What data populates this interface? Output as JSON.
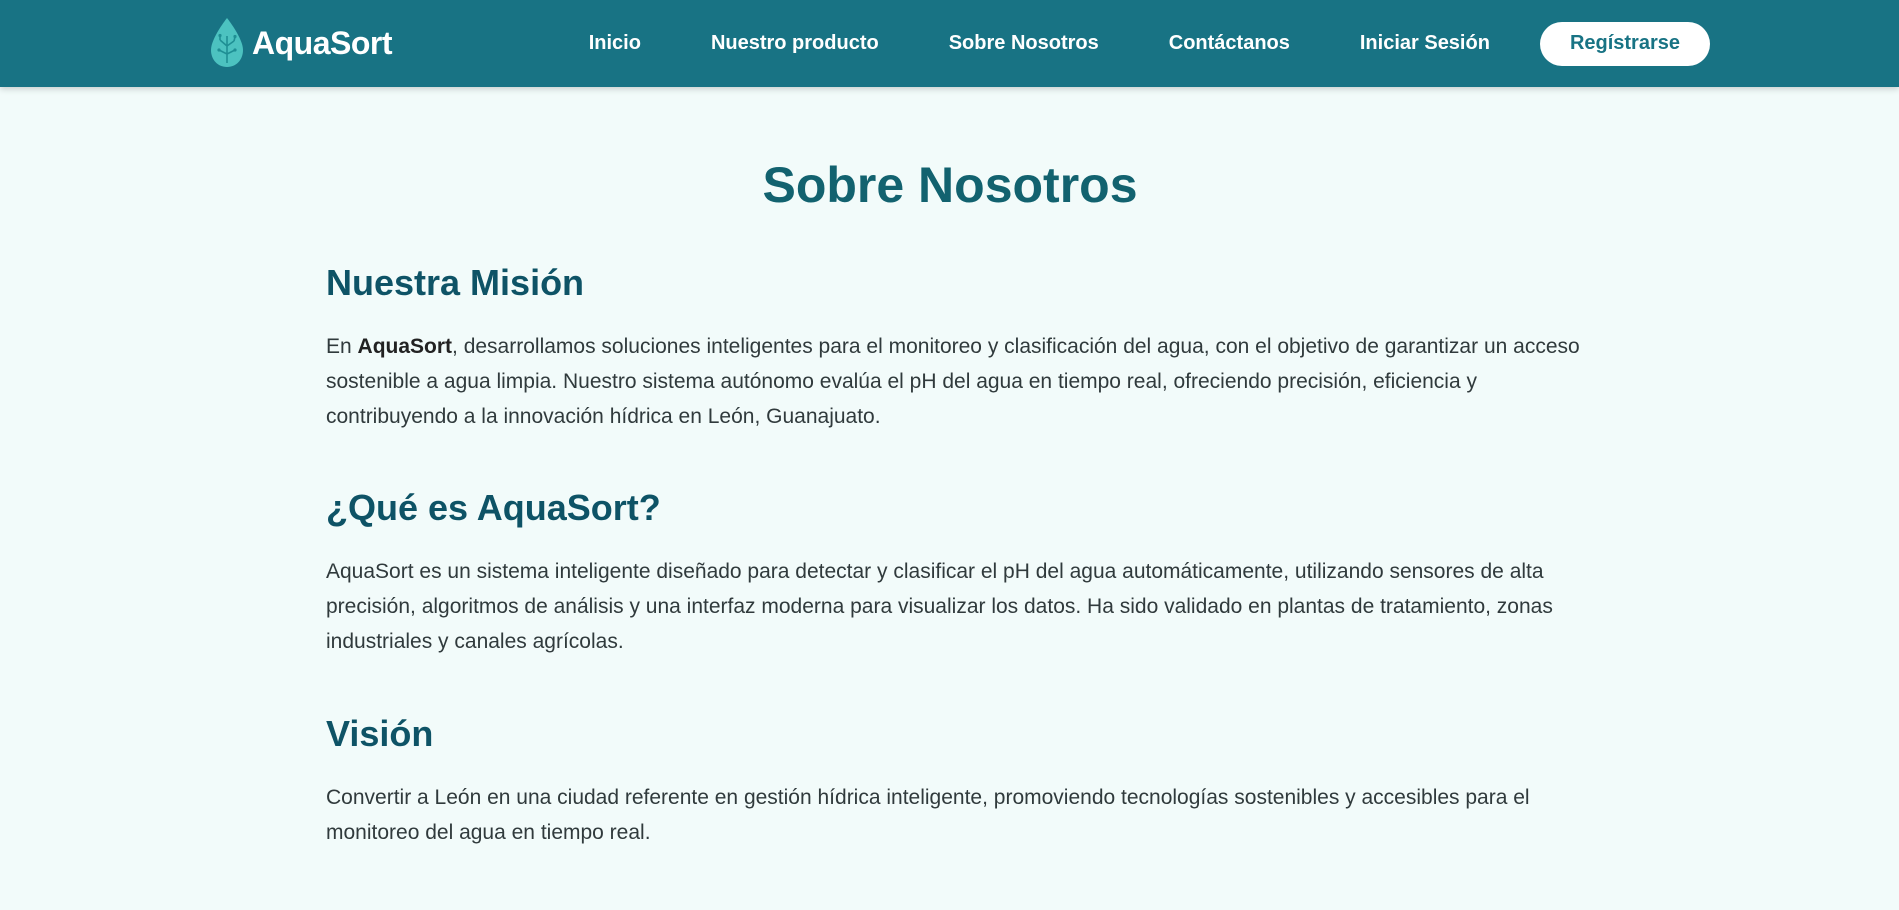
{
  "brand": {
    "name": "AquaSort",
    "logo_icon": "water-drop-circuit-icon"
  },
  "nav": {
    "items": [
      {
        "label": "Inicio"
      },
      {
        "label": "Nuestro producto"
      },
      {
        "label": "Sobre Nosotros"
      },
      {
        "label": "Contáctanos"
      },
      {
        "label": "Iniciar Sesión"
      }
    ],
    "register_label": "Regístrarse"
  },
  "page": {
    "title": "Sobre Nosotros"
  },
  "sections": [
    {
      "heading": "Nuestra Misión",
      "body_prefix": "En ",
      "body_strong": "AquaSort",
      "body": ", desarrollamos soluciones inteligentes para el monitoreo y clasificación del agua, con el objetivo de garantizar un acceso sostenible a agua limpia. Nuestro sistema autónomo evalúa el pH del agua en tiempo real, ofreciendo precisión, eficiencia y contribuyendo a la innovación hídrica en León, Guanajuato."
    },
    {
      "heading": "¿Qué es AquaSort?",
      "body": "AquaSort es un sistema inteligente diseñado para detectar y clasificar el pH del agua automáticamente, utilizando sensores de alta precisión, algoritmos de análisis y una interfaz moderna para visualizar los datos. Ha sido validado en plantas de tratamiento, zonas industriales y canales agrícolas."
    },
    {
      "heading": "Visión",
      "body": "Convertir a León en una ciudad referente en gestión hídrica inteligente, promoviendo tecnologías sostenibles y accesibles para el monitoreo del agua en tiempo real."
    }
  ],
  "colors": {
    "navbar": "#187384",
    "page_background": "#f2fbfa",
    "title": "#12626f",
    "heading": "#0e5366",
    "body_text": "#303a3c",
    "logo": "#4cc2c0"
  }
}
